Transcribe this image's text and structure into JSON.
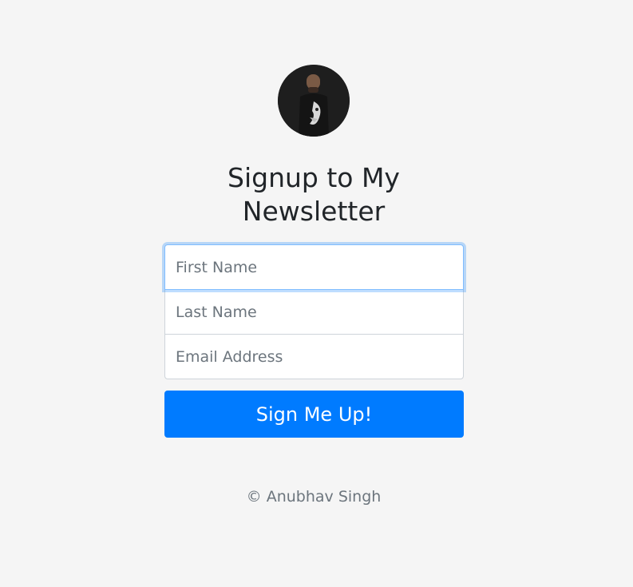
{
  "header": {
    "avatar_icon": "person-portrait-icon",
    "title_line1": "Signup to My",
    "title_line2": "Newsletter"
  },
  "form": {
    "first_name": {
      "placeholder": "First Name",
      "value": "",
      "focused": true
    },
    "last_name": {
      "placeholder": "Last Name",
      "value": ""
    },
    "email": {
      "placeholder": "Email Address",
      "value": ""
    },
    "submit_label": "Sign Me Up!"
  },
  "footer": {
    "text": "© Anubhav Singh"
  },
  "colors": {
    "background": "#f5f5f5",
    "primary": "#007bff",
    "focus_ring": "#80bdff",
    "muted_text": "#6c757d"
  }
}
